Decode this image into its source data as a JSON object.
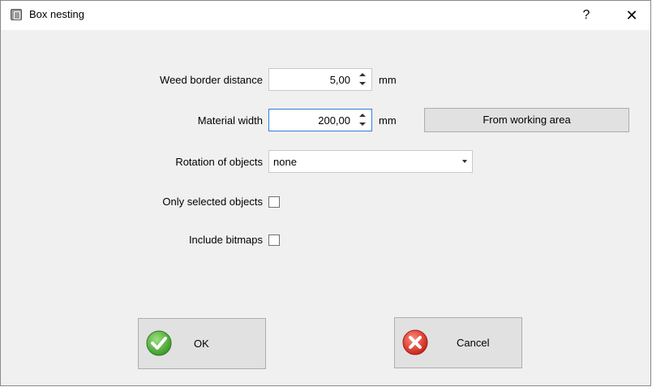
{
  "window": {
    "title": "Box nesting",
    "help_label": "?",
    "close_label": "✕",
    "app_icon": "app-icon"
  },
  "form": {
    "weed_border": {
      "label": "Weed border distance",
      "value": "5,00",
      "unit": "mm"
    },
    "material_width": {
      "label": "Material width",
      "value": "200,00",
      "unit": "mm",
      "button_label": "From working area"
    },
    "rotation": {
      "label": "Rotation of objects",
      "value": "none"
    },
    "only_selected": {
      "label": "Only selected objects",
      "checked": false
    },
    "include_bitmaps": {
      "label": "Include bitmaps",
      "checked": false
    }
  },
  "buttons": {
    "ok": {
      "label": "OK",
      "icon": "check-icon",
      "color": "#4caf3c"
    },
    "cancel": {
      "label": "Cancel",
      "icon": "cancel-icon",
      "color": "#e0463a"
    }
  }
}
